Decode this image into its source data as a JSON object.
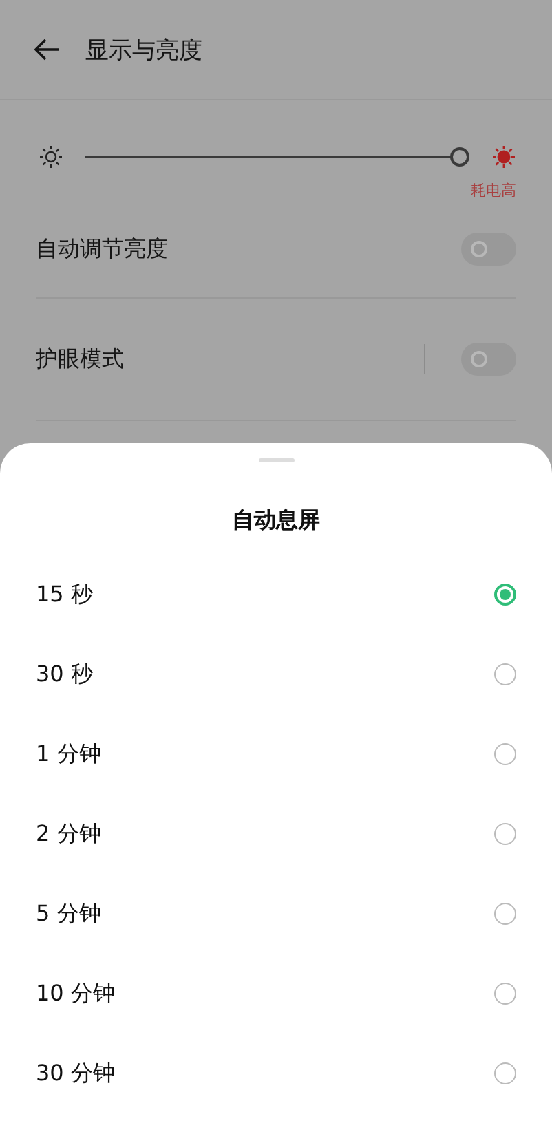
{
  "header": {
    "title": "显示与亮度"
  },
  "brightness": {
    "level": 1,
    "warning": "耗电高"
  },
  "settings": [
    {
      "label": "自动调节亮度",
      "on": false,
      "divider": false
    },
    {
      "label": "护眼模式",
      "on": false,
      "divider": true
    }
  ],
  "sheet": {
    "title": "自动息屏",
    "options": [
      {
        "label": "15 秒",
        "selected": true
      },
      {
        "label": "30 秒",
        "selected": false
      },
      {
        "label": "1 分钟",
        "selected": false
      },
      {
        "label": "2 分钟",
        "selected": false
      },
      {
        "label": "5 分钟",
        "selected": false
      },
      {
        "label": "10 分钟",
        "selected": false
      },
      {
        "label": "30 分钟",
        "selected": false
      }
    ]
  }
}
